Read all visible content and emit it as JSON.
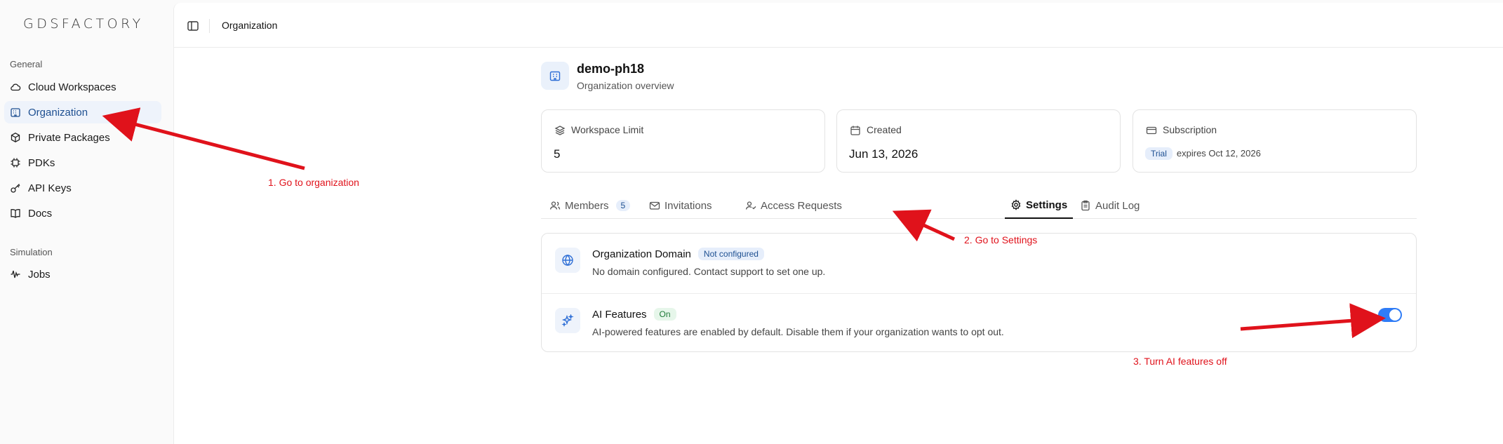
{
  "app": {
    "logo_text": "GDSFACTORY"
  },
  "sidebar": {
    "sections": [
      {
        "label": "General"
      },
      {
        "label": "Simulation"
      }
    ],
    "items": [
      {
        "label": "Cloud Workspaces",
        "icon": "cloud-icon"
      },
      {
        "label": "Organization",
        "icon": "building-icon",
        "active": true
      },
      {
        "label": "Private Packages",
        "icon": "package-icon"
      },
      {
        "label": "PDKs",
        "icon": "chip-icon"
      },
      {
        "label": "API Keys",
        "icon": "key-icon"
      },
      {
        "label": "Docs",
        "icon": "book-icon"
      },
      {
        "label": "Jobs",
        "icon": "waveform-icon"
      }
    ]
  },
  "topbar": {
    "breadcrumb": "Organization"
  },
  "org": {
    "name": "demo-ph18",
    "subtitle": "Organization overview"
  },
  "stats": {
    "workspace_limit": {
      "label": "Workspace Limit",
      "value": "5"
    },
    "created": {
      "label": "Created",
      "value": "Jun 13, 2026"
    },
    "subscription": {
      "label": "Subscription",
      "badge": "Trial",
      "expires": "expires Oct 12, 2026"
    }
  },
  "tabs": [
    {
      "label": "Members",
      "count": "5"
    },
    {
      "label": "Invitations"
    },
    {
      "label": "Access Requests"
    },
    {
      "label": "Settings",
      "active": true
    },
    {
      "label": "Audit Log"
    }
  ],
  "settings": {
    "domain": {
      "title": "Organization Domain",
      "badge": "Not configured",
      "description": "No domain configured. Contact support to set one up."
    },
    "ai": {
      "title": "AI Features",
      "badge": "On",
      "description": "AI-powered features are enabled by default. Disable them if your organization wants to opt out.",
      "enabled": true
    }
  },
  "annotations": {
    "step1": "1. Go to organization",
    "step2": "2. Go to Settings",
    "step3": "3. Turn AI features off",
    "color": "#e0121b"
  },
  "colors": {
    "accent": "#2f7cf6",
    "active_nav_bg": "#eef3fb",
    "active_nav_text": "#1d4f91"
  }
}
